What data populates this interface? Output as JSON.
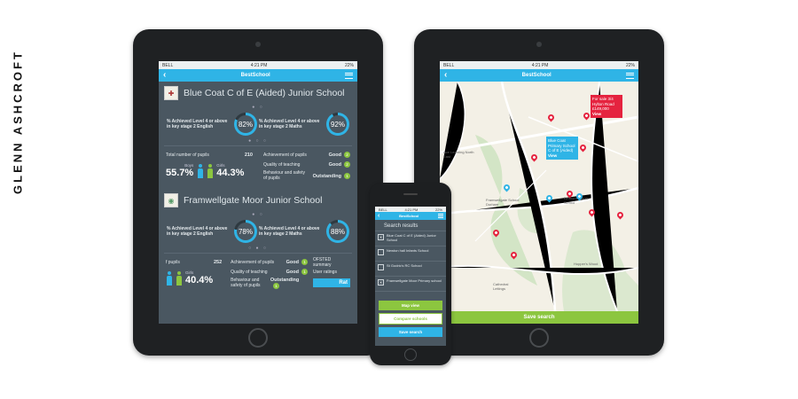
{
  "brand": "GLENN ASHCROFT",
  "app": {
    "name": "BestSchool",
    "time": "4:21 PM",
    "carrier": "BELL",
    "battery": "22%"
  },
  "left_tablet": {
    "school1": {
      "name": "Blue Coat C of E (Aided) Junior School",
      "eng_label": "% Achieved Level 4 or above in key stage 2 English",
      "eng_pct": "82%",
      "eng_value": 0.82,
      "maths_label": "% Achieved Level 4 or above in key stage 2 Maths",
      "maths_pct": "92%",
      "maths_value": 0.92,
      "pupils_label": "Total number of pupils",
      "pupils": "210",
      "boys_pct": "55.7%",
      "boys_label": "Boys",
      "girls_pct": "44.3%",
      "girls_label": "Girls",
      "achievement_label": "Achievement of pupils",
      "achievement": "Good",
      "achievement_num": "2",
      "teaching_label": "Quality of teaching",
      "teaching": "Good",
      "teaching_num": "2",
      "behaviour_label": "Behaviour and safety of pupils",
      "behaviour": "Outstanding",
      "behaviour_num": "1"
    },
    "school2": {
      "name": "Framwellgate Moor Junior School",
      "eng_label": "% Achieved Level 4 or above in key stage 2 English",
      "eng_pct": "78%",
      "eng_value": 0.78,
      "maths_label": "% Achieved Level 4 or above in key stage 2 Maths",
      "maths_pct": "88%",
      "maths_value": 0.88,
      "pupils_label": "f pupils",
      "pupils": "252",
      "girls_label": "Girls",
      "girls_pct": "40.4%",
      "achievement_label": "Achievement of pupils",
      "achievement": "Good",
      "achievement_num": "1",
      "teaching_label": "Quality of teaching",
      "teaching": "Good",
      "teaching_num": "1",
      "behaviour_label": "Behaviour and safety of pupils",
      "behaviour": "Outstanding",
      "behaviour_num": "1",
      "ofsted_label": "OFSTED summary",
      "user_ratings_label": "User ratings",
      "rate_button": "Rat"
    }
  },
  "right_tablet": {
    "popup_sale": "For sale 3/4 Hylton Road £149,000",
    "popup_sale_view": "View",
    "popup_school": "Blue Coat Primary School C of E (Aided)",
    "popup_school_view": "View",
    "save_search": "Save search",
    "map_labels": [
      "Framwellgate School Durham",
      "Belmont Infants School",
      "Hopper's Wood",
      "Cathedral Lettings",
      "Ace Learning North East"
    ]
  },
  "phone": {
    "title": "Search results",
    "results": [
      {
        "label": "Blue Coat C of E (Aided) Junior School",
        "checked": true
      },
      {
        "label": "Newton hall Infants School",
        "checked": false
      },
      {
        "label": "St Godric's RC School",
        "checked": false
      },
      {
        "label": "Framwellgate Moor Primary school",
        "checked": true
      }
    ],
    "map_view": "Map view",
    "compare": "Compare schools",
    "save_search": "Save search"
  },
  "colors": {
    "accent_blue": "#2fb4e6",
    "accent_green": "#8cc63f",
    "sale_red": "#e5233f",
    "panel_grey": "#4a5761"
  }
}
